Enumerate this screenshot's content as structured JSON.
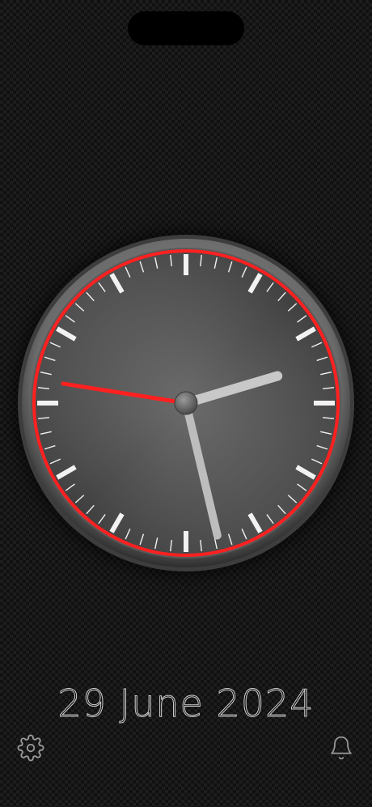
{
  "date_text": "29 June 2024",
  "clock": {
    "hour": 2,
    "minute": 27,
    "second": 46.5,
    "accent_color": "#ff2020",
    "hand_color": "#c8c8c8"
  },
  "icons": {
    "settings": "gear-icon",
    "alarm": "bell-icon"
  }
}
